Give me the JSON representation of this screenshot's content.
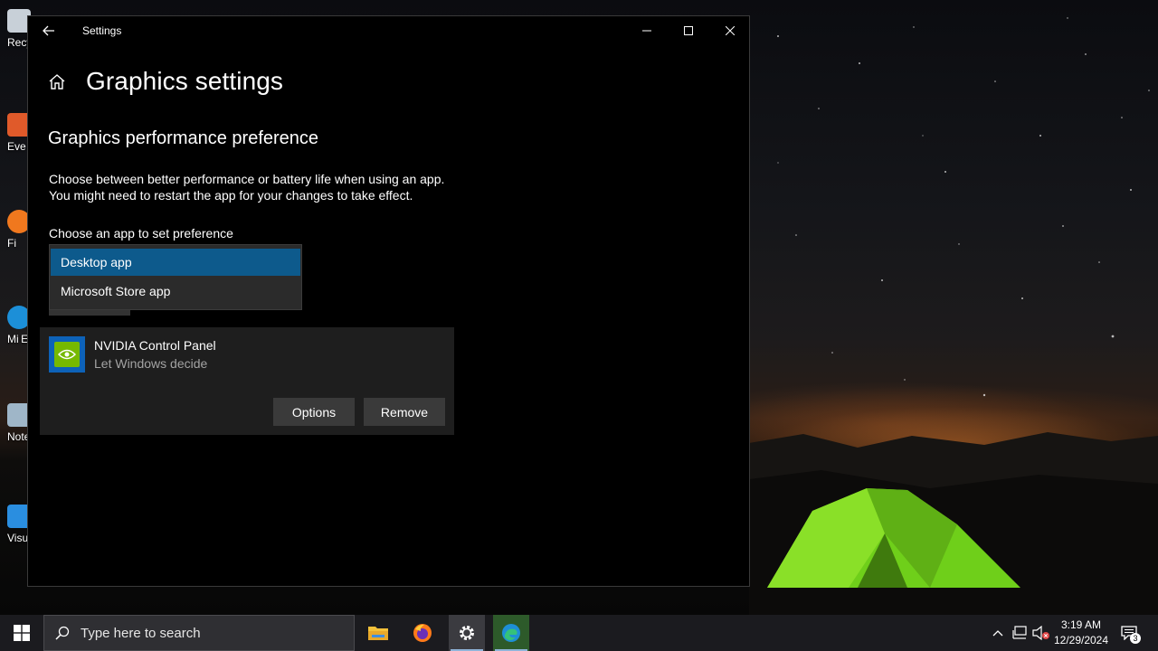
{
  "window": {
    "title": "Settings",
    "page_title": "Graphics settings",
    "section_title": "Graphics performance preference",
    "description_line1": "Choose between better performance or battery life when using an app.",
    "description_line2": "You might need to restart the app for your changes to take effect.",
    "choose_label": "Choose an app to set preference",
    "dropdown_options": [
      "Desktop app",
      "Microsoft Store app"
    ],
    "dropdown_selected": "Desktop app",
    "app": {
      "name": "NVIDIA Control Panel",
      "preference": "Let Windows decide"
    },
    "options_button": "Options",
    "remove_button": "Remove"
  },
  "desktop_icons": [
    {
      "label": "Recy",
      "icon": "recycle-bin-icon"
    },
    {
      "label": "Eve",
      "icon": "app-shortcut-icon"
    },
    {
      "label": "Fi",
      "icon": "firefox-icon"
    },
    {
      "label": "Mi E",
      "icon": "edge-icon"
    },
    {
      "label": "Note",
      "icon": "notepad-icon"
    },
    {
      "label": "Visua C",
      "icon": "vscode-icon"
    }
  ],
  "taskbar": {
    "search_placeholder": "Type here to search",
    "apps": [
      "file-explorer-icon",
      "firefox-icon",
      "settings-icon",
      "edge-icon"
    ],
    "time": "3:19 AM",
    "date": "12/29/2024",
    "notification_count": "3"
  },
  "colors": {
    "selection": "#0d5a8c",
    "button": "#3a3a3a",
    "card": "#1e1e1e",
    "nvidia_green": "#76b900"
  }
}
